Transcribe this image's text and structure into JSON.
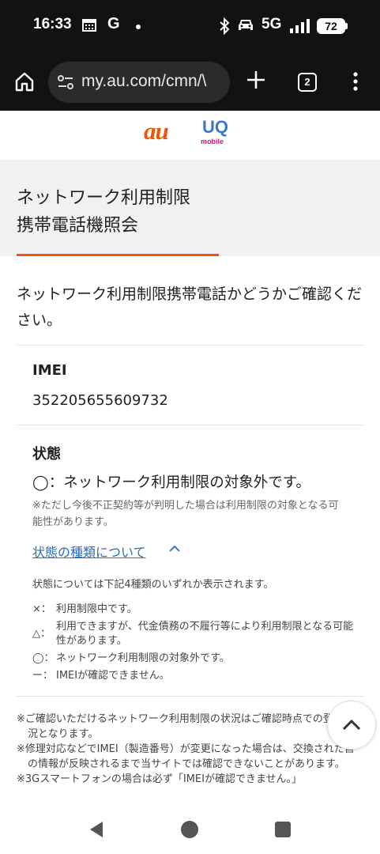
{
  "status_bar": {
    "time": "16:33",
    "carrier_letter": "G",
    "network": "5G",
    "battery": "72",
    "icons": [
      "calendar-icon",
      "bluetooth-icon",
      "car-icon",
      "signal-icon",
      "battery-icon"
    ]
  },
  "browser": {
    "url": "my.au.com/cmn/\\",
    "tab_count": "2",
    "icons": [
      "home-icon",
      "site-settings-icon",
      "plus-icon",
      "tabs-icon",
      "menu-icon"
    ]
  },
  "logos": {
    "au": "au",
    "uq": "UQ",
    "uq_sub": "mobile"
  },
  "page": {
    "title_line1": "ネットワーク利用制限",
    "title_line2": "携帯電話機照会",
    "intro": "ネットワーク利用制限携帯電話かどうかご確認ください。",
    "imei_label": "IMEI",
    "imei_value": "352205655609732",
    "status_label": "状態",
    "status_value": "◯：ネットワーク利用制限の対象外です。",
    "status_note": "※ただし今後不正契約等が判明した場合は利用制限の対象となる可能性があります。",
    "toggle_link": "状態の種類について",
    "legend_intro": "状態については下記4種類のいずれか表示されます。",
    "legend": [
      {
        "symbol": "×：",
        "text": "利用制限中です。"
      },
      {
        "symbol": "△：",
        "text": "利用できますが、代金債務の不履行等により利用制限となる可能性があります。"
      },
      {
        "symbol": "◯：",
        "text": "ネットワーク利用制限の対象外です。"
      },
      {
        "symbol": "ー：",
        "text": "IMEIが確認できません。"
      }
    ],
    "footnotes": [
      "※ご確認いただけるネットワーク利用制限の状況はご確認時点での登録状況となります。",
      "※修理対応などでIMEI（製造番号）が変更になった場合は、交換された旨の情報が反映されるまで当サイトでは確認できないことがあります。",
      "※3Gスマートフォンの場合は必ず「IMEIが確認できません。」"
    ]
  },
  "colors": {
    "accent": "#eb5505",
    "link": "#2a6db8",
    "title_band": "#f1f1f1",
    "browser_chrome": "#121212"
  }
}
